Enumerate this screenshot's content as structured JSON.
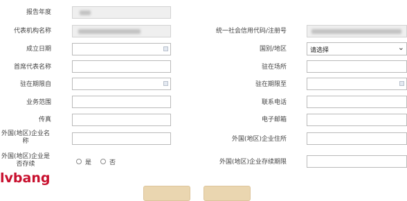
{
  "form": {
    "report_year": {
      "label": "报告年度",
      "value": ""
    },
    "rep_org_name": {
      "label": "代表机构名称",
      "value": ""
    },
    "credit_code": {
      "label": "统一社会信用代码/注册号",
      "value": ""
    },
    "established_date": {
      "label": "成立日期",
      "value": ""
    },
    "country": {
      "label": "国别/地区",
      "selected": "请选择"
    },
    "chief_rep_name": {
      "label": "首席代表名称",
      "value": ""
    },
    "residence": {
      "label": "驻在场所",
      "value": ""
    },
    "term_from": {
      "label": "驻在期限自",
      "value": ""
    },
    "term_to": {
      "label": "驻在期限至",
      "value": ""
    },
    "business_scope": {
      "label": "业务范围",
      "value": ""
    },
    "phone": {
      "label": "联系电话",
      "value": ""
    },
    "fax": {
      "label": "传真",
      "value": ""
    },
    "email": {
      "label": "电子邮箱",
      "value": ""
    },
    "foreign_company_name": {
      "label_line1": "外国(地区)企业名",
      "label_line2": "称",
      "value": ""
    },
    "foreign_company_address": {
      "label": "外国(地区)企业住所",
      "value": ""
    },
    "foreign_company_exists": {
      "label_line1": "外国(地区)企业是",
      "label_line2": "否存续",
      "options": [
        "是",
        "否"
      ]
    },
    "foreign_company_term": {
      "label": "外国(地区)企业存续期限",
      "value": ""
    }
  },
  "watermark": {
    "text": "lvbang",
    "color": "#c8102e"
  },
  "colors": {
    "button": "#ead6b0",
    "disabled_field": "#efefef"
  }
}
